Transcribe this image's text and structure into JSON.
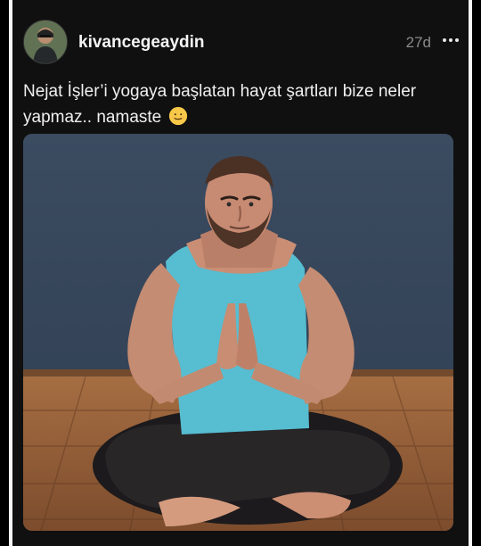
{
  "post": {
    "username": "kivancegeaydin",
    "time": "27d",
    "caption": "Nejat İşler’i yogaya başlatan hayat şartları bize neler yapmaz.. namaste",
    "caption_emoji": "smiling-face-icon",
    "more_icon": "more-horizontal-icon",
    "photo_description_icon": "photo"
  },
  "colors": {
    "background": "#101010",
    "text": "#f0f0f0",
    "muted": "#8a8a8a",
    "wall": "#3d4b5f",
    "floor": "#8a5632",
    "shirt": "#58bdd0"
  }
}
